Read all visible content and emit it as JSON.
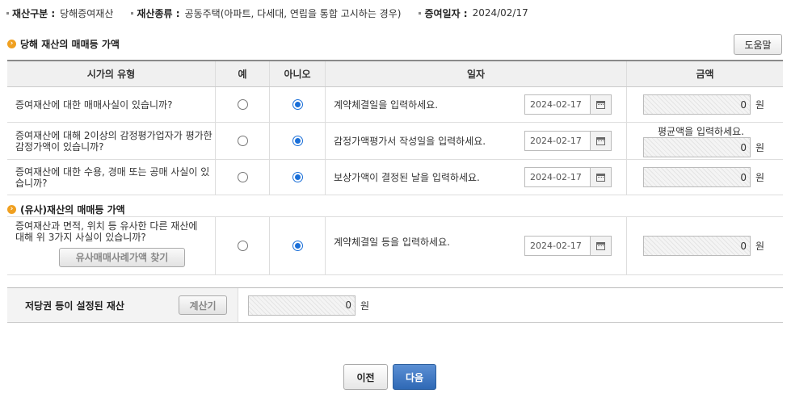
{
  "info": [
    {
      "label": "재산구분 :",
      "value": "당해증여재산"
    },
    {
      "label": "재산종류 :",
      "value": "공동주택(아파트, 다세대, 연립을 통합 고시하는 경우)"
    },
    {
      "label": "증여일자 :",
      "value": "2024/02/17"
    }
  ],
  "section1": {
    "title": "당해 재산의 매매등 가액",
    "help_label": "도움말"
  },
  "table": {
    "headers": [
      "시가의 유형",
      "예",
      "아니오",
      "일자",
      "금액"
    ],
    "rows": [
      {
        "q": "증여재산에 대한 매매사실이 있습니까?",
        "date_desc": "계약체결일을 입력하세요.",
        "date": "2024-02-17",
        "amount": "0",
        "unit": "원",
        "yes": false,
        "no": true
      },
      {
        "q": "증여재산에 대해 2이상의 감정평가업자가 평가한 감정가액이 있습니까?",
        "date_desc": "감정가액평가서 작성일을 입력하세요.",
        "date": "2024-02-17",
        "amount": "0",
        "unit": "원",
        "note": "평균액을 입력하세요.",
        "yes": false,
        "no": true
      },
      {
        "q": "증여재산에 대한 수용, 경매 또는 공매 사실이 있습니까?",
        "date_desc": "보상가액이 결정된 날을 입력하세요.",
        "date": "2024-02-17",
        "amount": "0",
        "unit": "원",
        "yes": false,
        "no": true
      }
    ]
  },
  "section2": {
    "title": "(유사)재산의 매매등 가액",
    "row": {
      "q": "증여재산과 면적, 위치 등 유사한 다른 재산에 대해 위 3가지 사실이 있습니까?",
      "button": "유사매매사례가액 찾기",
      "date_desc": "계약체결일 등을 입력하세요.",
      "date": "2024-02-17",
      "amount": "0",
      "unit": "원",
      "yes": false,
      "no": true
    }
  },
  "mortgage": {
    "label": "저당권 등이 설정된 재산",
    "calc_label": "계산기",
    "amount": "0",
    "unit": "원"
  },
  "nav": {
    "prev": "이전",
    "next": "다음"
  }
}
